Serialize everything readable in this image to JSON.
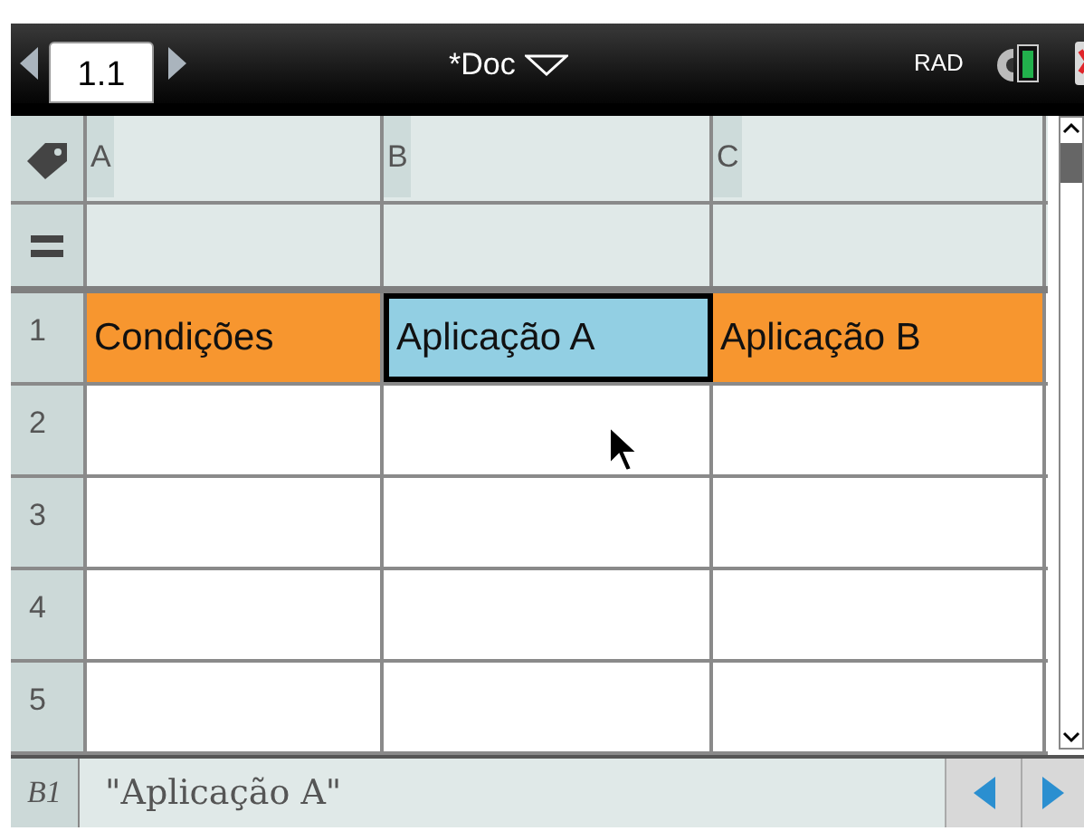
{
  "title_bar": {
    "tab": "1.1",
    "document": "*Doc",
    "angle_mode": "RAD"
  },
  "columns": [
    "A",
    "B",
    "C"
  ],
  "rows": [
    {
      "label": "1",
      "cells": [
        {
          "text": "Condições",
          "selected": false,
          "color": "#f7962f"
        },
        {
          "text": "Aplicação A",
          "selected": true,
          "color": "#92cfe3"
        },
        {
          "text": "Aplicação B",
          "selected": false,
          "color": "#f7962f"
        }
      ]
    },
    {
      "label": "2",
      "cells": []
    },
    {
      "label": "3",
      "cells": []
    },
    {
      "label": "4",
      "cells": []
    },
    {
      "label": "5",
      "cells": []
    }
  ],
  "entry_line": {
    "cell_ref": "B1",
    "content": "\"Aplicação A\""
  }
}
